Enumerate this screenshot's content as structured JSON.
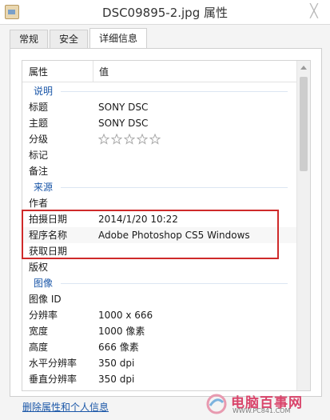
{
  "window": {
    "title": "DSC09895-2.jpg 属性",
    "close_glyph": "╳"
  },
  "tabs": [
    {
      "label": "常规"
    },
    {
      "label": "安全"
    },
    {
      "label": "详细信息"
    }
  ],
  "list": {
    "header_name": "属性",
    "header_value": "值",
    "sections": {
      "description": "说明",
      "origin": "来源",
      "image": "图像"
    },
    "rows": {
      "title": {
        "k": "标题",
        "v": "SONY DSC"
      },
      "subject": {
        "k": "主题",
        "v": "SONY DSC"
      },
      "rating": {
        "k": "分级",
        "stars": 5,
        "rating": 0
      },
      "tags": {
        "k": "标记",
        "v": ""
      },
      "comments": {
        "k": "备注",
        "v": ""
      },
      "authors": {
        "k": "作者",
        "v": ""
      },
      "date_taken": {
        "k": "拍摄日期",
        "v": "2014/1/20 10:22"
      },
      "program": {
        "k": "程序名称",
        "v": "Adobe Photoshop CS5 Windows"
      },
      "date_acquired": {
        "k": "获取日期",
        "v": ""
      },
      "copyright": {
        "k": "版权",
        "v": ""
      },
      "image_id": {
        "k": "图像 ID",
        "v": ""
      },
      "dimensions": {
        "k": "分辨率",
        "v": "1000 x 666"
      },
      "width": {
        "k": "宽度",
        "v": "1000 像素"
      },
      "height": {
        "k": "高度",
        "v": "666 像素"
      },
      "h_res": {
        "k": "水平分辨率",
        "v": "350 dpi"
      },
      "v_res": {
        "k": "垂直分辨率",
        "v": "350 dpi"
      }
    }
  },
  "footer": {
    "remove_link": "删除属性和个人信息"
  },
  "watermark": {
    "text": "电脑百事网",
    "url": "WWW.PC841.COM"
  },
  "colors": {
    "highlight": "#cf2a2a",
    "link": "#1b57a8",
    "section_heading": "#1b57a8"
  }
}
